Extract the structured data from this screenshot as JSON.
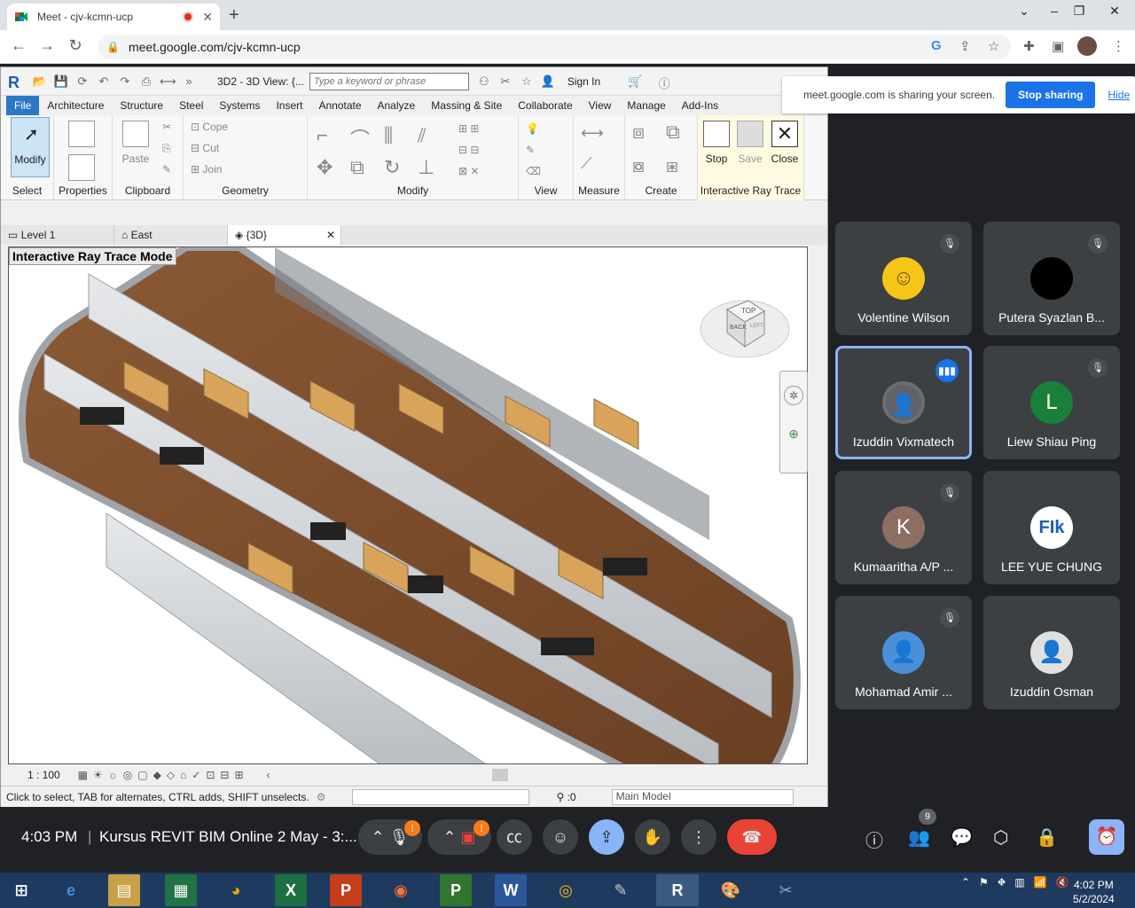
{
  "browser": {
    "tab_title": "Meet - cjv-kcmn-ucp",
    "url": "meet.google.com/cjv-kcmn-ucp"
  },
  "revit": {
    "title": "3D2 - 3D View: {...",
    "search_placeholder": "Type a keyword or phrase",
    "sign_in": "Sign In",
    "ribbon_tabs": [
      "File",
      "Architecture",
      "Structure",
      "Steel",
      "Systems",
      "Insert",
      "Annotate",
      "Analyze",
      "Massing & Site",
      "Collaborate",
      "View",
      "Manage",
      "Add-Ins"
    ],
    "groups": {
      "select": "Select",
      "properties": "Properties",
      "clipboard": "Clipboard",
      "geometry": "Geometry",
      "modify": "Modify",
      "view": "View",
      "measure": "Measure",
      "create": "Create",
      "ray_trace": "Interactive Ray Trace"
    },
    "buttons": {
      "modify": "Modify",
      "paste": "Paste",
      "cope": "Cope",
      "cut": "Cut",
      "join": "Join",
      "stop": "Stop",
      "save": "Save",
      "close": "Close"
    },
    "view_tabs": [
      "Level 1",
      "East",
      "{3D}"
    ],
    "viewport_label": "Interactive Ray Trace Mode",
    "viewcube": {
      "top": "TOP",
      "back": "BACK",
      "left": "LEFT"
    },
    "scale": "1 : 100",
    "status_text": "Click to select, TAB for alternates, CTRL adds, SHIFT unselects.",
    "selection_count": ":0",
    "model": "Main Model"
  },
  "share_banner": {
    "message": "meet.google.com is sharing your screen.",
    "stop": "Stop sharing",
    "hide": "Hide"
  },
  "participants": [
    {
      "name": "Volentine Wilson",
      "initial": "",
      "color": "#f5c518",
      "muted": true
    },
    {
      "name": "Putera Syazlan B...",
      "initial": "",
      "color": "#000000",
      "muted": true
    },
    {
      "name": "Izuddin Vixmatech",
      "initial": "",
      "color": "#5f6368",
      "muted": false
    },
    {
      "name": "Liew Shiau Ping",
      "initial": "L",
      "color": "#188038",
      "muted": true
    },
    {
      "name": "Kumaaritha A/P ...",
      "initial": "K",
      "color": "#8d6e63",
      "muted": true
    },
    {
      "name": "LEE YUE CHUNG",
      "initial": "",
      "color": "#ffffff",
      "muted": false
    },
    {
      "name": "Mohamad Amir ...",
      "initial": "",
      "color": "#4a90d9",
      "muted": true
    },
    {
      "name": "Izuddin Osman",
      "initial": "",
      "color": "#e0e0e0",
      "muted": false
    }
  ],
  "meet_bar": {
    "time": "4:03 PM",
    "meeting": "Kursus REVIT BIM Online 2 May - 3:...",
    "participant_count": "9"
  },
  "taskbar": {
    "time": "4:02 PM",
    "date": "5/2/2024"
  }
}
